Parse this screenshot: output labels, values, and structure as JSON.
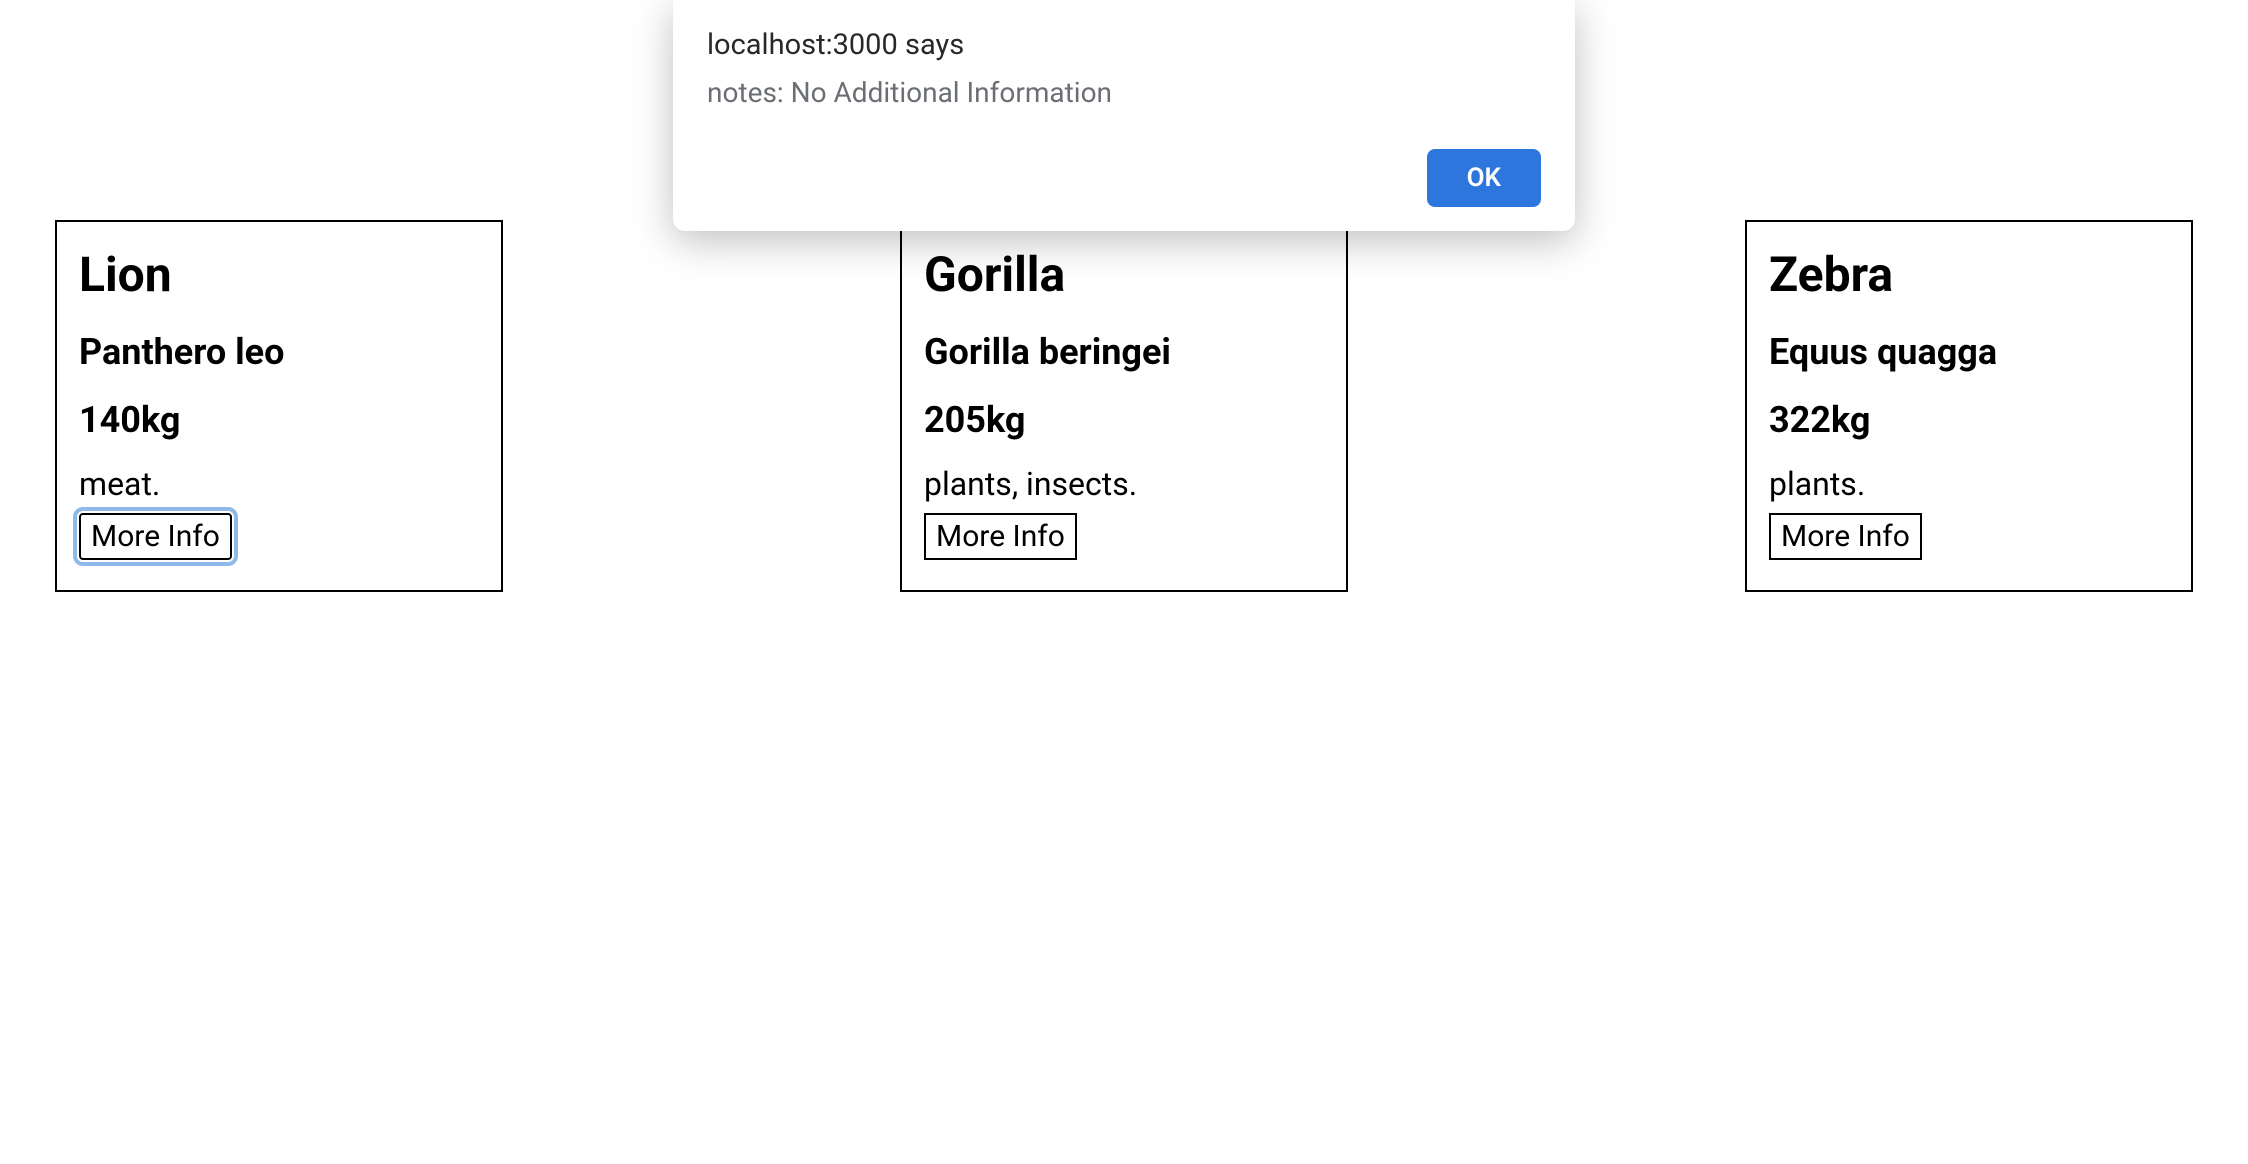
{
  "alert": {
    "title": "localhost:3000 says",
    "message": "notes: No Additional Information",
    "ok_label": "OK"
  },
  "cards": [
    {
      "name": "Lion",
      "species": "Panthero leo",
      "weight": "140kg",
      "diet": "meat.",
      "button_label": "More Info",
      "focused": true
    },
    {
      "name": "Gorilla",
      "species": "Gorilla beringei",
      "weight": "205kg",
      "diet": "plants, insects.",
      "button_label": "More Info",
      "focused": false
    },
    {
      "name": "Zebra",
      "species": "Equus quagga",
      "weight": "322kg",
      "diet": "plants.",
      "button_label": "More Info",
      "focused": false
    }
  ]
}
